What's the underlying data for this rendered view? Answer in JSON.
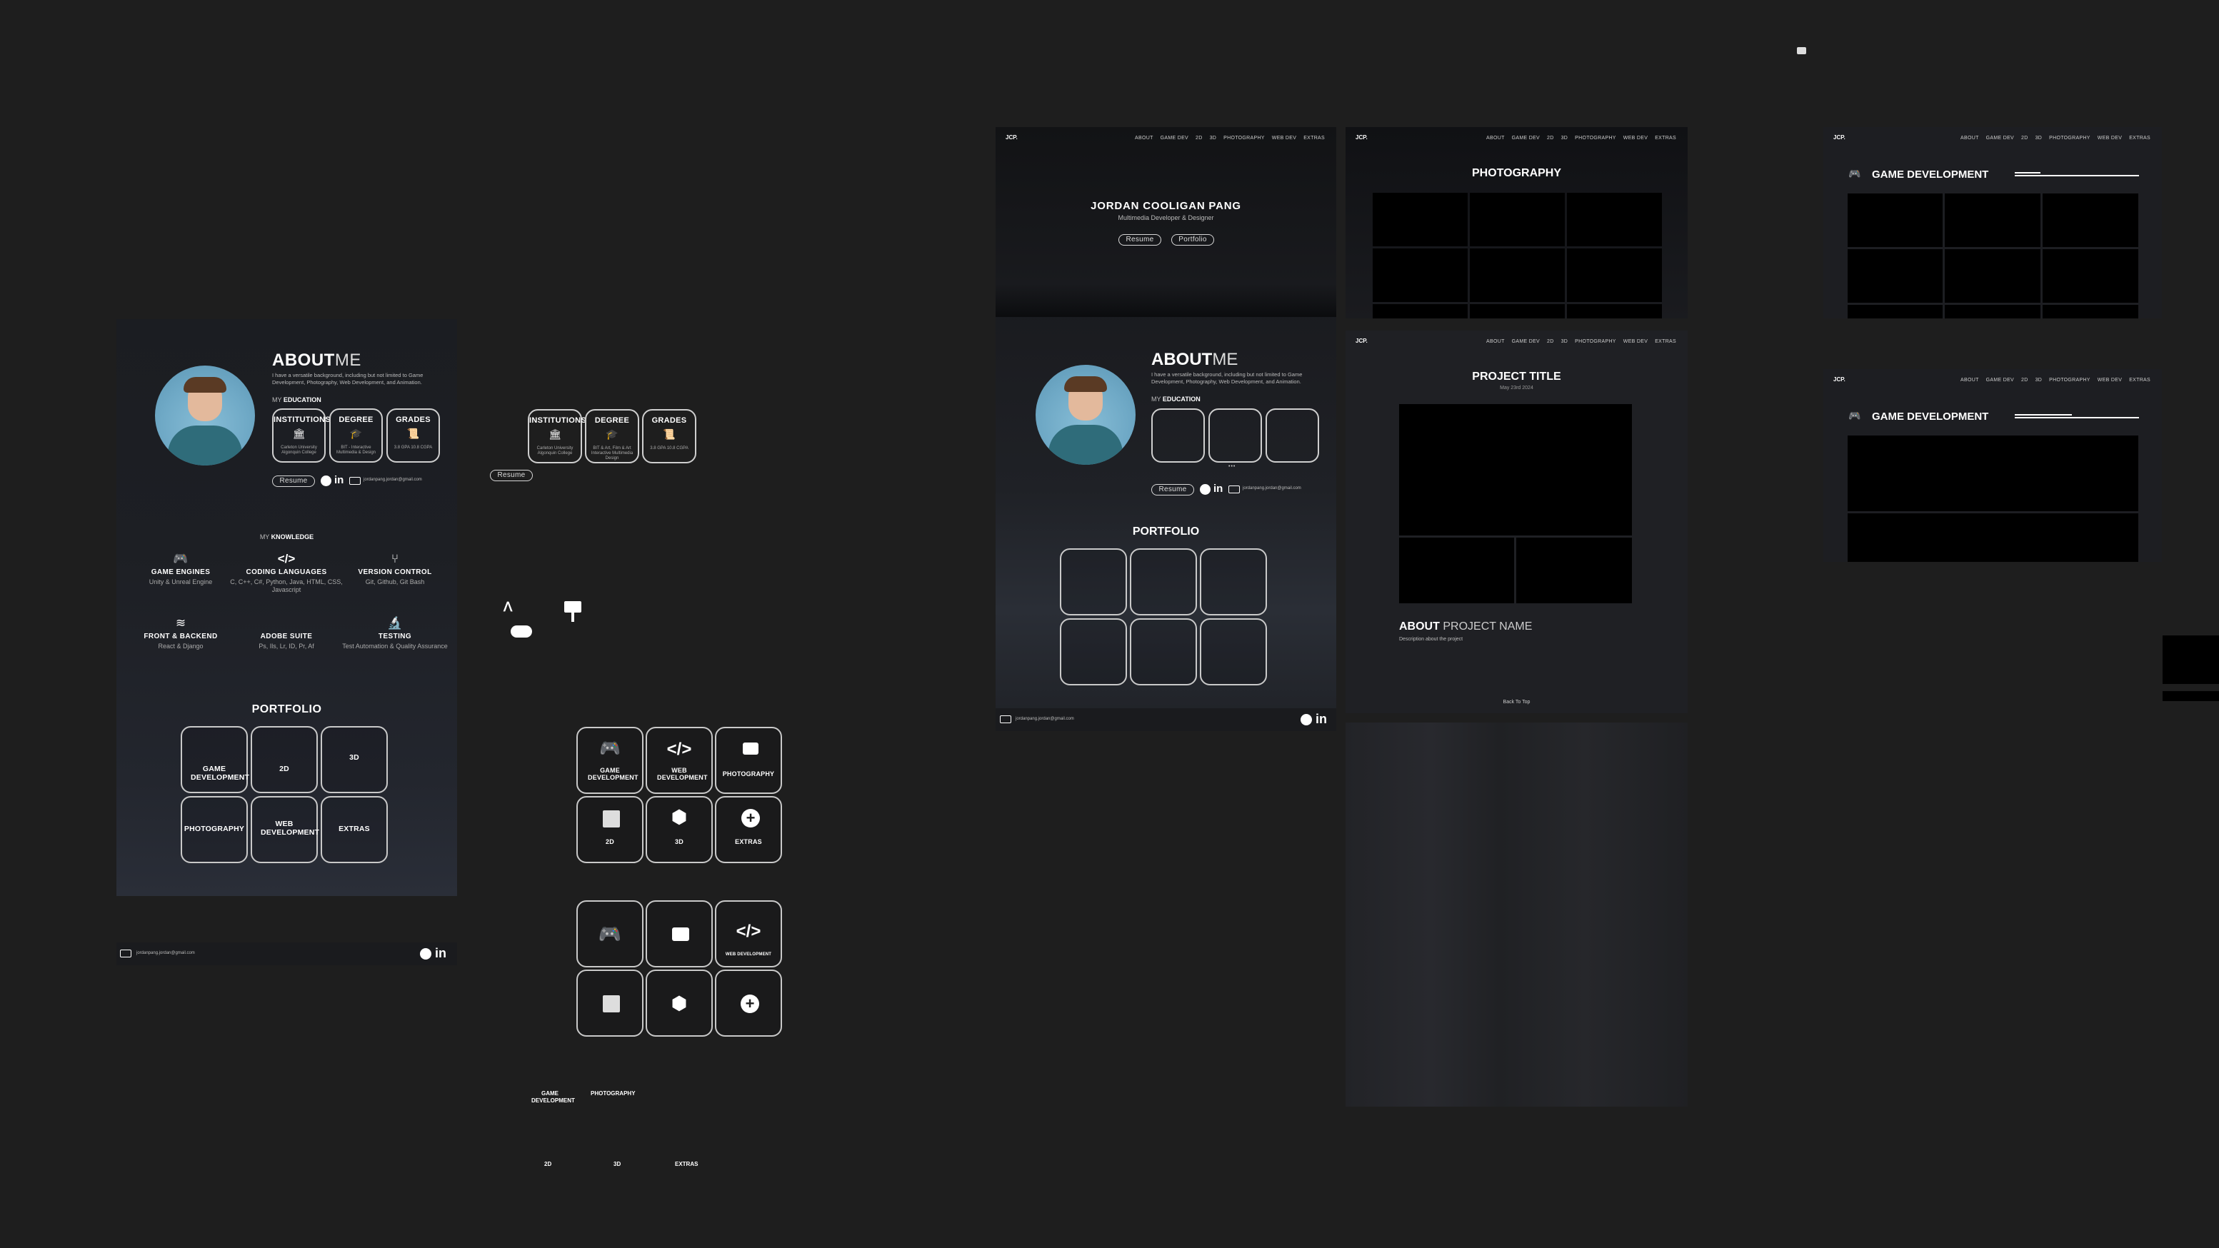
{
  "profile": {
    "about_bold": "ABOUT",
    "about_light": "ME",
    "intro": "I have a versatile background, including but not limited to Game Development, Photography, Web Development, and Animation.",
    "my": "MY",
    "education": "EDUCATION",
    "edu": [
      {
        "title": "INSTITUTIONS",
        "sub": "Carleton University Algonquin College"
      },
      {
        "title": "DEGREE",
        "sub": "BIT - Interactive Multimedia & Design"
      },
      {
        "title": "GRADES",
        "sub": "3.8 GPA 10.8 CGPA"
      }
    ],
    "resume": "Resume",
    "email": "jordanpang.jordan@gmail.com",
    "knowledge_my": "MY",
    "knowledge": "KNOWLEDGE",
    "skills": [
      {
        "title": "GAME ENGINES",
        "desc": "Unity & Unreal Engine",
        "icon": "gamepad-icon"
      },
      {
        "title": "CODING LANGUAGES",
        "desc": "C, C++, C#, Python, Java, HTML, CSS, Javascript",
        "icon": "code-icon"
      },
      {
        "title": "VERSION CONTROL",
        "desc": "Git, Github, Git Bash",
        "icon": "git-branch-icon"
      },
      {
        "title": "FRONT & BACKEND",
        "desc": "React & Django",
        "icon": "layers-icon"
      },
      {
        "title": "ADOBE SUITE",
        "desc": "Ps, Ils, Lr, ID, Pr, Af",
        "icon": "adobe-icon"
      },
      {
        "title": "TESTING",
        "desc": "Test Automation & Quality Assurance",
        "icon": "microscope-icon"
      }
    ],
    "portfolio": "PORTFOLIO",
    "portfolio_items": [
      "GAME DEVELOPMENT",
      "2D",
      "3D",
      "PHOTOGRAPHY",
      "WEB DEVELOPMENT",
      "EXTRAS"
    ]
  },
  "components": {
    "edu": [
      {
        "title": "INSTITUTIONS",
        "sub": "Carleton University Algonquin College"
      },
      {
        "title": "DEGREE",
        "sub": "BIT & Art, Film & Art Interactive Multimedia Design"
      },
      {
        "title": "GRADES",
        "sub": "3.8 GPA 10.8 CGPA"
      }
    ],
    "resume": "Resume",
    "grid1": [
      "GAME DEVELOPMENT",
      "WEB DEVELOPMENT",
      "PHOTOGRAPHY",
      "2D",
      "3D",
      "EXTRAS"
    ],
    "grid2_label": "WEB DEVELOPMENT",
    "loose": [
      "GAME DEVELOPMENT",
      "PHOTOGRAPHY",
      "2D",
      "3D",
      "EXTRAS"
    ]
  },
  "site": {
    "logo": "JCP.",
    "nav": [
      "ABOUT",
      "GAME DEV",
      "2D",
      "3D",
      "PHOTOGRAPHY",
      "WEB DEV",
      "EXTRAS"
    ],
    "hero_name": "JORDAN COOLIGAN PANG",
    "hero_role": "Multimedia Developer & Designer",
    "hero_buttons": [
      "Resume",
      "Portfolio"
    ],
    "ellipsis": "•••",
    "photography_title": "PHOTOGRAPHY",
    "project_title": "PROJECT TITLE",
    "project_date": "May 23rd 2024",
    "about_project_bold": "ABOUT",
    "about_project_light": "PROJECT NAME",
    "project_desc": "Description about the project",
    "back_to_top": "Back To Top",
    "gamedev_title": "GAME DEVELOPMENT"
  },
  "colors": {
    "canvas": "#1e1e1e",
    "panel": "#1f2024",
    "dark": "#000000",
    "accent_avatar": "#6fa9c6"
  }
}
